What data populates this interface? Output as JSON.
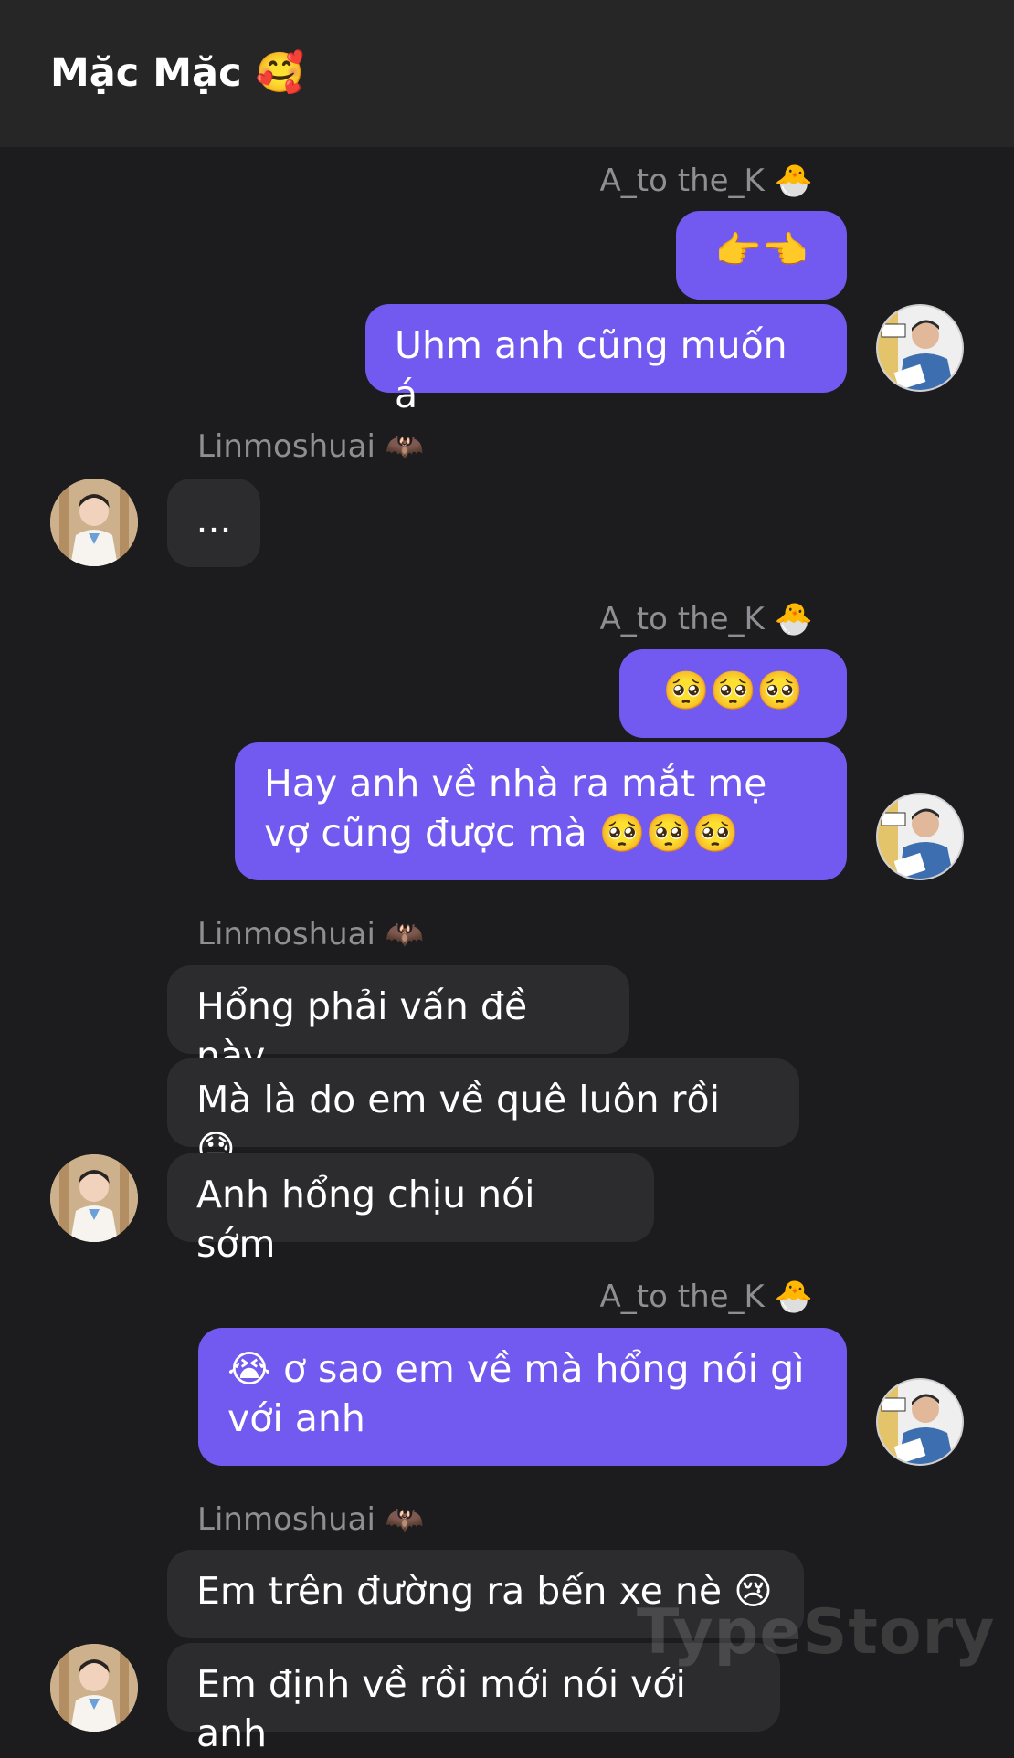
{
  "header": {
    "title": "Mặc Mặc",
    "title_emoji": "🥰"
  },
  "messages": [
    {
      "sender": "A_to the_K",
      "sender_emoji": "🐣",
      "texts": [
        "👉👈",
        "Uhm anh cũng muốn á"
      ]
    },
    {
      "sender": "Linmoshuai",
      "sender_emoji": "🦇",
      "texts": [
        "..."
      ]
    },
    {
      "sender": "A_to the_K",
      "sender_emoji": "🐣",
      "texts": [
        "🥺🥺🥺",
        "Hay anh về nhà ra mắt mẹ vợ cũng được mà 🥺🥺🥺"
      ]
    },
    {
      "sender": "Linmoshuai",
      "sender_emoji": "🦇",
      "texts": [
        "Hổng phải vấn đề này",
        "Mà là do em về quê luôn rồi 😓",
        "Anh hổng chịu nói sớm"
      ]
    },
    {
      "sender": "A_to the_K",
      "sender_emoji": "🐣",
      "texts": [
        "😭 ơ sao em về mà hổng nói gì với anh"
      ]
    },
    {
      "sender": "Linmoshuai",
      "sender_emoji": "🦇",
      "texts": [
        "Em trên đường ra bến xe nè 😢",
        "Em định về rồi mới nói với anh"
      ]
    }
  ],
  "watermark": "TypeStory",
  "colors": {
    "background": "#1c1c1e",
    "header": "#262627",
    "outgoing_bubble": "#7259f0",
    "incoming_bubble": "#2c2c2e",
    "sender_text": "#8e8e93"
  }
}
